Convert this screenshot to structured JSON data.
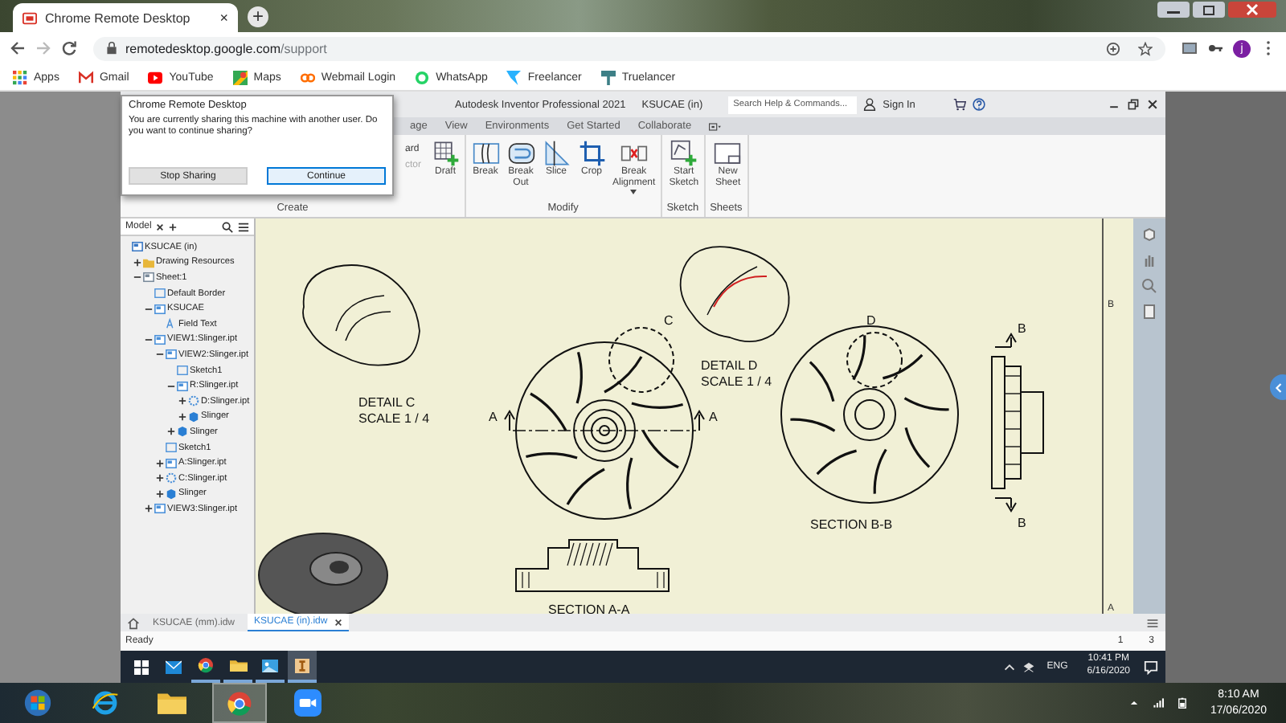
{
  "browser": {
    "tab_title": "Chrome Remote Desktop",
    "tab_close": "×",
    "new_tab": "+",
    "url_host": "remotedesktop.google.com",
    "url_path": "/support",
    "profile_initial": "j",
    "bookmarks": [
      {
        "label": "Apps",
        "kind": "apps"
      },
      {
        "label": "Gmail",
        "kind": "gmail"
      },
      {
        "label": "YouTube",
        "kind": "youtube"
      },
      {
        "label": "Maps",
        "kind": "maps"
      },
      {
        "label": "Webmail Login",
        "kind": "webmail"
      },
      {
        "label": "WhatsApp",
        "kind": "whatsapp"
      },
      {
        "label": "Freelancer",
        "kind": "freelancer"
      },
      {
        "label": "Truelancer",
        "kind": "truelancer"
      }
    ]
  },
  "dialog": {
    "title": "Chrome Remote Desktop",
    "message": "You are currently sharing this machine with another user. Do you want to continue sharing?",
    "buttons": [
      {
        "label": "Stop Sharing",
        "selected": false
      },
      {
        "label": "Continue",
        "selected": true
      }
    ]
  },
  "inventor": {
    "app_title": "Autodesk Inventor Professional 2021",
    "document_title": "KSUCAE (in)",
    "search_placeholder": "Search Help & Commands...",
    "sign_in": "Sign In",
    "menu_tabs": [
      "age",
      "View",
      "Environments",
      "Get Started",
      "Collaborate"
    ],
    "ribbon_panels": [
      {
        "label": "Create",
        "tools": [
          {
            "label": "ard",
            "kind": "small",
            "disabled": false
          },
          {
            "label": "ctor",
            "kind": "small",
            "disabled": true
          },
          {
            "label": "Draft",
            "kind": "draft"
          }
        ]
      },
      {
        "label": "Modify",
        "tools": [
          {
            "label": "Break",
            "kind": "break"
          },
          {
            "label": "Break Out",
            "kind": "break_out"
          },
          {
            "label": "Slice",
            "kind": "slice"
          },
          {
            "label": "Crop",
            "kind": "crop"
          },
          {
            "label": "Break Alignment",
            "kind": "alignment"
          }
        ]
      },
      {
        "label": "Sketch",
        "tools": [
          {
            "label": "Start Sketch",
            "kind": "sketch"
          }
        ]
      },
      {
        "label": "Sheets",
        "tools": [
          {
            "label": "New Sheet",
            "kind": "sheet"
          }
        ]
      }
    ]
  },
  "model_browser": {
    "tab": "Model",
    "tree": [
      {
        "label": "KSUCAE (in)",
        "kind": "document",
        "children": [
          {
            "label": "Drawing Resources",
            "kind": "folder",
            "expanded": false
          },
          {
            "label": "Sheet:1",
            "kind": "sheet",
            "expanded": true,
            "children": [
              {
                "label": "Default Border",
                "kind": "border"
              },
              {
                "label": "KSUCAE",
                "kind": "title_block",
                "expanded": true,
                "children": [
                  {
                    "label": "Field Text",
                    "kind": "text"
                  }
                ]
              },
              {
                "label": "VIEW1:Slinger.ipt",
                "kind": "view",
                "expanded": true,
                "children": [
                  {
                    "label": "VIEW2:Slinger.ipt",
                    "kind": "view",
                    "expanded": true,
                    "children": [
                      {
                        "label": "Sketch1",
                        "kind": "sketch"
                      },
                      {
                        "label": "R:Slinger.ipt",
                        "kind": "section",
                        "expanded": true,
                        "children": [
                          {
                            "label": "D:Slinger.ipt",
                            "kind": "detail",
                            "expanded": false
                          },
                          {
                            "label": "Slinger",
                            "kind": "part",
                            "expanded": false
                          }
                        ]
                      },
                      {
                        "label": "Slinger",
                        "kind": "part",
                        "expanded": false
                      }
                    ]
                  },
                  {
                    "label": "Sketch1",
                    "kind": "sketch"
                  },
                  {
                    "label": "A:Slinger.ipt",
                    "kind": "section",
                    "expanded": false
                  },
                  {
                    "label": "C:Slinger.ipt",
                    "kind": "detail",
                    "expanded": false
                  },
                  {
                    "label": "Slinger",
                    "kind": "part",
                    "expanded": false
                  }
                ]
              },
              {
                "label": "VIEW3:Slinger.ipt",
                "kind": "view",
                "expanded": false
              }
            ]
          }
        ]
      }
    ]
  },
  "drawing": {
    "detail_c_title": "DETAIL  C",
    "detail_c_scale": "SCALE 1 / 4",
    "detail_c_mark": "C",
    "section_a_marks": [
      "A",
      "A"
    ],
    "detail_d_title": "DETAIL  D",
    "detail_d_scale": "SCALE 1 / 4",
    "detail_d_mark": "D",
    "section_b_title": "SECTION B-B",
    "section_b_marks": [
      "B",
      "B"
    ],
    "section_a_title": "SECTION A-A",
    "border_zones": [
      "B",
      "A"
    ]
  },
  "doc_tabs": [
    {
      "label": "KSUCAE (mm).idw",
      "selected": false
    },
    {
      "label": "KSUCAE (in).idw",
      "selected": true
    }
  ],
  "status_bar": {
    "text": "Ready",
    "sheet_numbers": [
      "1",
      "3"
    ]
  },
  "remote_taskbar": {
    "apps": [
      {
        "kind": "start",
        "running": false,
        "selected": false
      },
      {
        "kind": "mail",
        "running": false,
        "selected": false
      },
      {
        "kind": "chrome",
        "running": true,
        "selected": false
      },
      {
        "kind": "folder",
        "running": true,
        "selected": false
      },
      {
        "kind": "photos",
        "running": true,
        "selected": false
      },
      {
        "kind": "inventor",
        "running": true,
        "selected": true
      }
    ],
    "language": "ENG",
    "time": "10:41 PM",
    "date": "6/16/2020"
  },
  "local_taskbar": {
    "apps": [
      {
        "kind": "start",
        "selected": false
      },
      {
        "kind": "ie",
        "selected": false
      },
      {
        "kind": "folder",
        "selected": false
      },
      {
        "kind": "chrome",
        "selected": true
      },
      {
        "kind": "zoom",
        "selected": false
      }
    ],
    "time": "8:10 AM",
    "date": "17/06/2020"
  }
}
